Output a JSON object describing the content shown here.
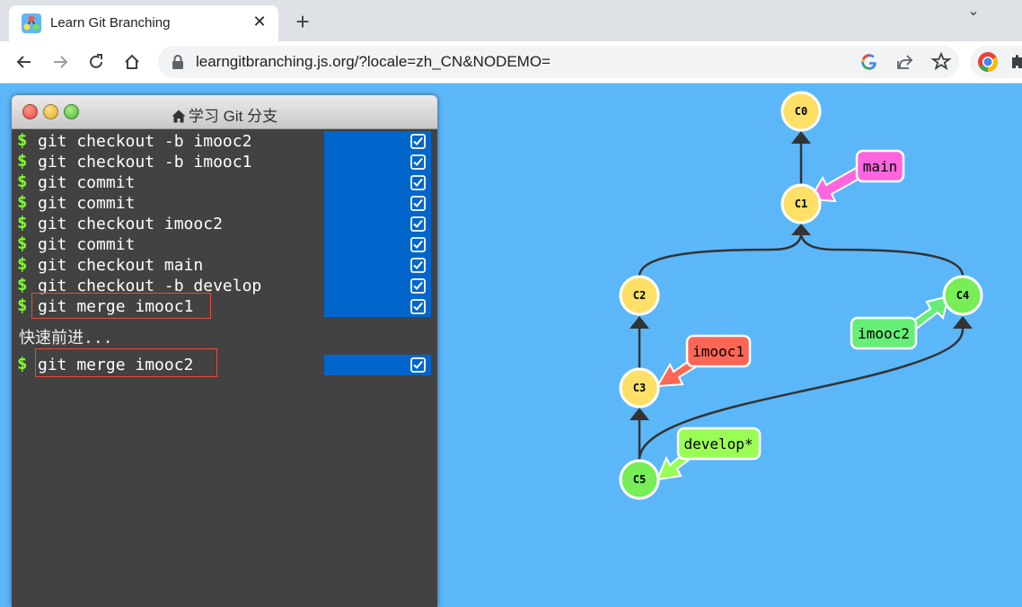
{
  "browser": {
    "tab_title": "Learn Git Branching",
    "tab_close": "✕",
    "new_tab": "+",
    "tab_menu": "⌄",
    "url": "learngitbranching.js.org/?locale=zh_CN&NODEMO="
  },
  "terminal": {
    "title": "学习 Git 分支",
    "prompt": "$",
    "commands": [
      {
        "text": "git checkout -b imooc2"
      },
      {
        "text": "git checkout -b imooc1"
      },
      {
        "text": "git commit"
      },
      {
        "text": "git commit"
      },
      {
        "text": "git checkout imooc2"
      },
      {
        "text": "git commit"
      },
      {
        "text": "git checkout main"
      },
      {
        "text": "git checkout -b develop"
      },
      {
        "text": "git merge imooc1"
      }
    ],
    "output": "快速前进...",
    "last_command": "git merge imooc2"
  },
  "graph": {
    "commits": [
      "C0",
      "C1",
      "C2",
      "C3",
      "C4",
      "C5"
    ],
    "branches": {
      "main": "main",
      "imooc1": "imooc1",
      "imooc2": "imooc2",
      "develop": "develop*"
    },
    "colors": {
      "commit_yellow": "#ffe066",
      "commit_green": "#77ee55",
      "main": "#ff66dd",
      "imooc1": "#ff6655",
      "imooc2": "#66ee77",
      "develop": "#99ff55",
      "background": "#5cb7f9"
    }
  }
}
